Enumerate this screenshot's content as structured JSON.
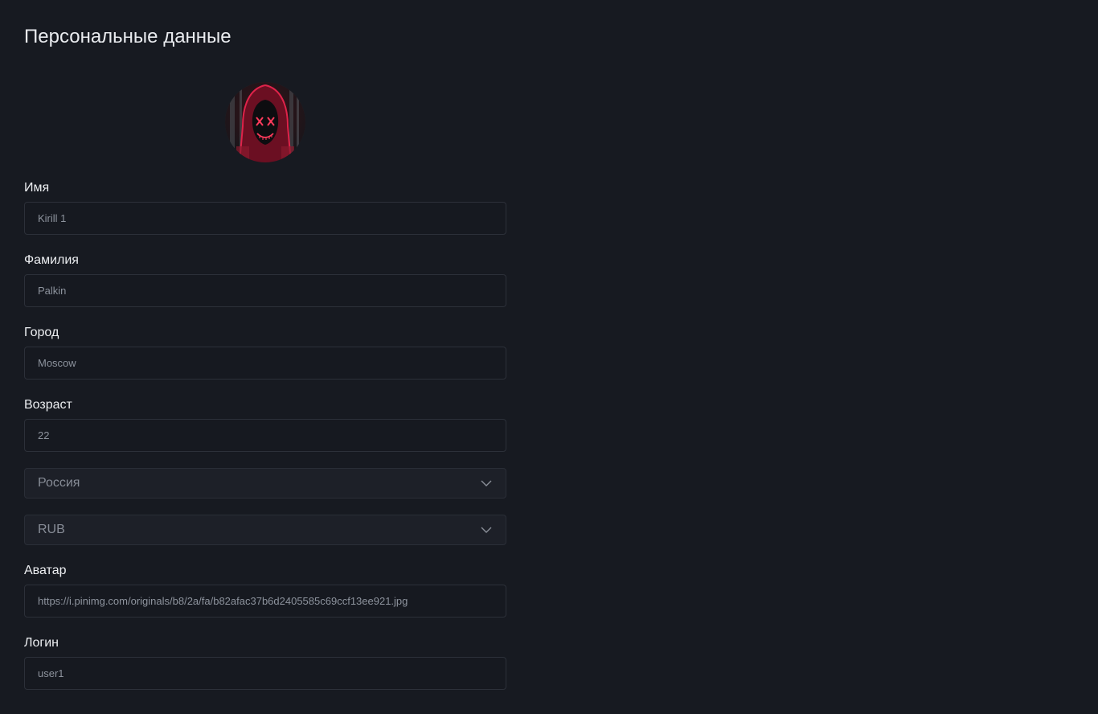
{
  "page": {
    "title": "Персональные данные"
  },
  "fields": {
    "first_name": {
      "label": "Имя",
      "value": "Kirill 1"
    },
    "last_name": {
      "label": "Фамилия",
      "value": "Palkin"
    },
    "city": {
      "label": "Город",
      "value": "Moscow"
    },
    "age": {
      "label": "Возраст",
      "value": "22"
    },
    "country": {
      "value": "Россия"
    },
    "currency": {
      "value": "RUB"
    },
    "avatar_url": {
      "label": "Аватар",
      "value": "https://i.pinimg.com/originals/b8/2a/fa/b82afac37b6d2405585c69ccf13ee921.jpg"
    },
    "login": {
      "label": "Логин",
      "value": "user1"
    }
  },
  "icons": {
    "select_chevron": "chevron-down-icon"
  },
  "colors": {
    "background": "#171a21",
    "input_background": "#161920",
    "select_background": "#1d2028",
    "border": "#2c3039",
    "avatar_accent": "#e0234a"
  }
}
